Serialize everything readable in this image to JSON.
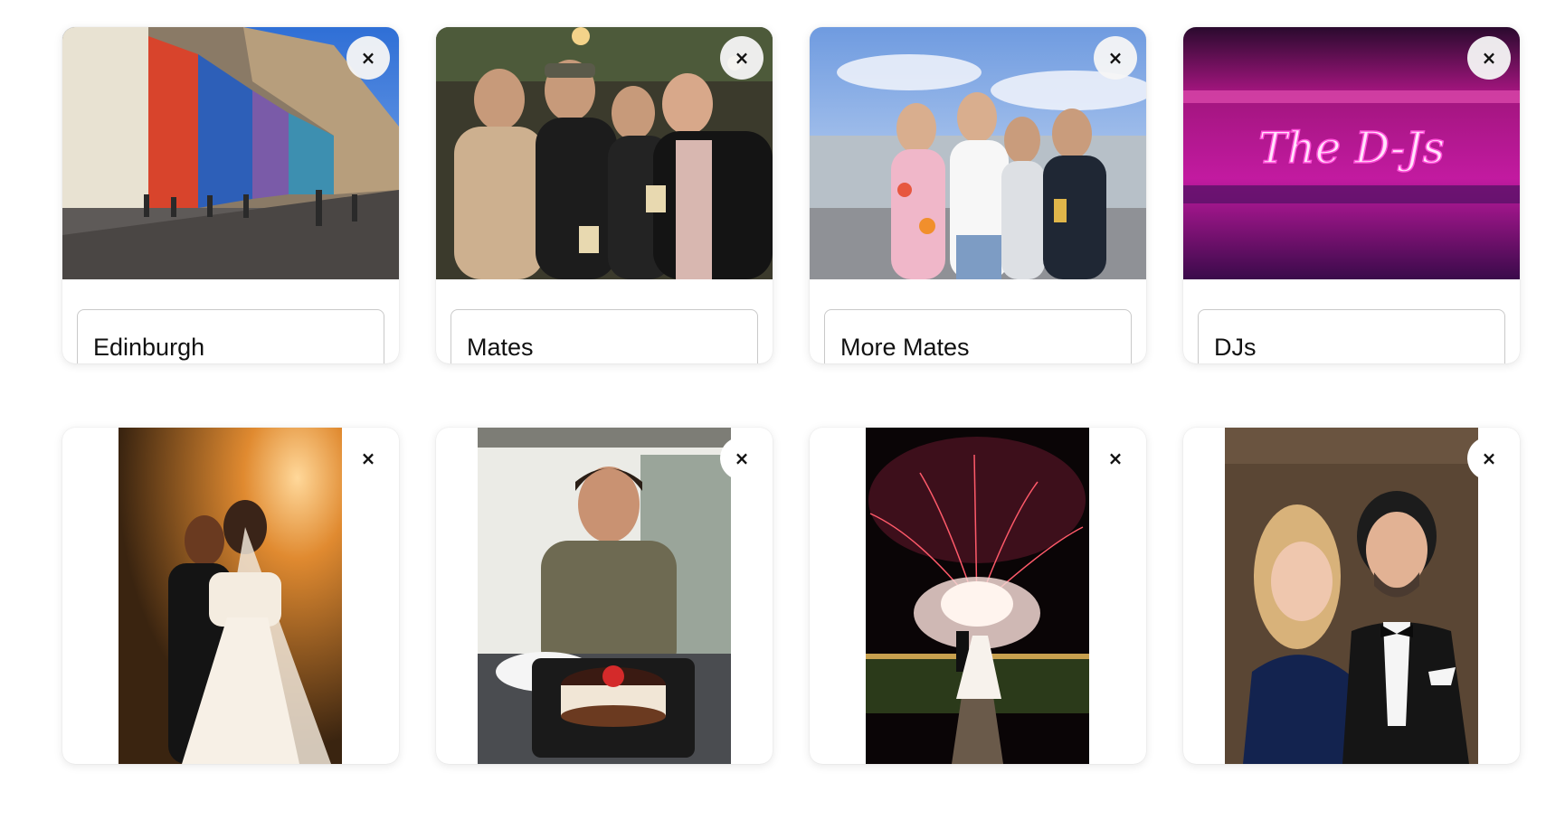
{
  "gallery": {
    "remove_glyph": "×",
    "labelled_photos": [
      {
        "caption": "Edinburgh",
        "subject": "edinburgh-street-photo"
      },
      {
        "caption": "Mates",
        "subject": "mates-photo"
      },
      {
        "caption": "More Mates",
        "subject": "more-mates-photo"
      },
      {
        "caption": "DJs",
        "subject": "djs-neon-sign-photo",
        "sign_text": "The D-Js"
      }
    ],
    "portrait_photos": [
      {
        "subject": "wedding-couple-sunset-photo"
      },
      {
        "subject": "man-with-cake-photo"
      },
      {
        "subject": "fireworks-couple-photo"
      },
      {
        "subject": "couple-selfie-photo"
      }
    ]
  },
  "colors": {
    "card_background": "#ffffff",
    "input_border": "#c9c9c9",
    "neon_pink": "#ff4fd8"
  }
}
